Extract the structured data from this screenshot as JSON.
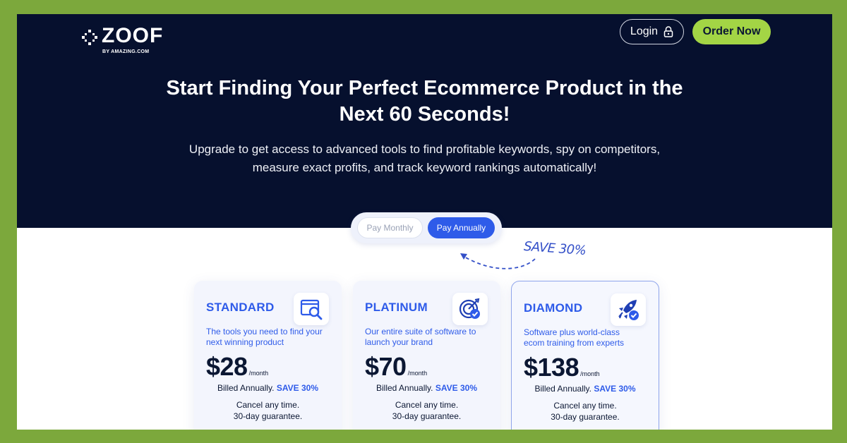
{
  "brand": {
    "name": "ZOOF",
    "tagline": "BY AMAZING.COM"
  },
  "header": {
    "login_label": "Login",
    "order_label": "Order Now"
  },
  "hero": {
    "headline_line1": "Start Finding Your Perfect Ecommerce Product in the",
    "headline_line2": "Next 60 Seconds!",
    "sub_line1": "Upgrade to get access to advanced tools to find profitable keywords, spy on competitors,",
    "sub_line2": "measure exact profits, and track keyword rankings automatically!"
  },
  "billing_toggle": {
    "monthly_label": "Pay Monthly",
    "annual_label": "Pay Annually",
    "selected": "Pay Annually",
    "save_note": "SAVE 30%"
  },
  "plans": [
    {
      "name": "STANDARD",
      "icon": "search-window-icon",
      "desc_line1": "The tools you need to find your",
      "desc_line2": "next winning product",
      "price": "$28",
      "period": "/month",
      "billed": "Billed Annually.",
      "save": "SAVE 30%",
      "cancel_line1": "Cancel any time.",
      "cancel_line2": "30-day guarantee."
    },
    {
      "name": "PLATINUM",
      "icon": "target-check-icon",
      "desc_line1": "Our entire suite of software to",
      "desc_line2": "launch your brand",
      "price": "$70",
      "period": "/month",
      "billed": "Billed Annually.",
      "save": "SAVE 30%",
      "cancel_line1": "Cancel any time.",
      "cancel_line2": "30-day guarantee."
    },
    {
      "name": "DIAMOND",
      "icon": "rocket-check-icon",
      "desc_line1": "Software plus world-class",
      "desc_line2": "ecom training from experts",
      "price": "$138",
      "period": "/month",
      "billed": "Billed Annually.",
      "save": "SAVE 30%",
      "cancel_line1": "Cancel any time.",
      "cancel_line2": "30-day guarantee."
    }
  ],
  "colors": {
    "hero_bg": "#06102e",
    "accent_blue": "#2e5be9",
    "order_green": "#a3d545",
    "frame_green": "#7ca83c"
  }
}
